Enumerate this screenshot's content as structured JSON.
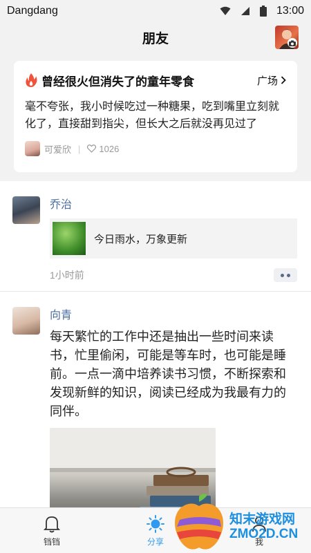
{
  "status_bar": {
    "carrier": "Dangdang",
    "time": "13:00",
    "icons": [
      "wifi-icon",
      "signal-icon",
      "battery-icon"
    ]
  },
  "header": {
    "title": "朋友",
    "avatar_icon": "camera-icon"
  },
  "topic": {
    "icon": "fire-icon",
    "title": "曾经很火但消失了的童年零食",
    "plaza_label": "广场",
    "text": "毫不夸张，我小时候吃过一种糖果，吃到嘴里立刻就化了，直接甜到指尖，但长大之后就没再见过了",
    "author": "可爱欣",
    "likes": "1026",
    "colors": {
      "fire": "#f0533a"
    }
  },
  "feed": {
    "posts": [
      {
        "name": "乔治",
        "share_text": "今日雨水，万象更新",
        "time": "1小时前"
      },
      {
        "name": "向青",
        "text": "每天繁忙的工作中还是抽出一些时间来读书，忙里偷闲，可能是等车时，也可能是睡前。一点一滴中培养读书习惯，不断探索和发现新鲜的知识，阅读已经成为我最有力的同伴。"
      }
    ]
  },
  "tabbar": {
    "tabs": [
      {
        "label": "铛铛",
        "icon": "bell-icon",
        "active": false
      },
      {
        "label": "分享",
        "icon": "sun-icon",
        "active": true
      },
      {
        "label": "我",
        "icon": "person-icon",
        "active": false
      }
    ],
    "accent": "#2f9bf0"
  },
  "watermark": {
    "line1": "知末游戏网",
    "line2": "ZMO2D.CN"
  }
}
